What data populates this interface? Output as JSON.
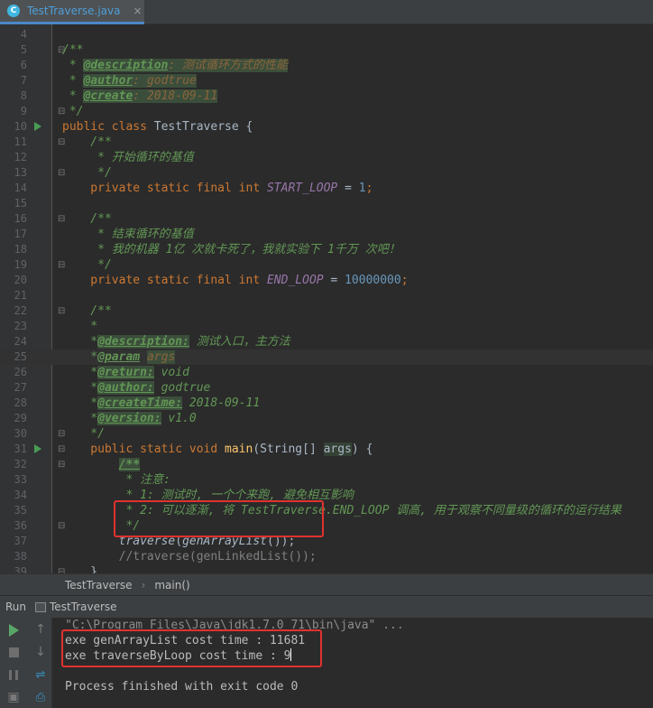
{
  "tab": {
    "icon": "C",
    "label": "TestTraverse.java",
    "close": "×"
  },
  "lines": [
    {
      "n": "4",
      "segs": []
    },
    {
      "n": "5",
      "fold": "⊟",
      "segs": [
        {
          "t": "/**",
          "c": "c-com"
        }
      ]
    },
    {
      "n": "6",
      "segs": [
        {
          "t": " * ",
          "c": "c-com"
        },
        {
          "t": "@description",
          "c": "c-tag"
        },
        {
          "t": ": 测试循环方式的性能",
          "c": "c-tagval"
        }
      ]
    },
    {
      "n": "7",
      "segs": [
        {
          "t": " * ",
          "c": "c-com"
        },
        {
          "t": "@author",
          "c": "c-tag"
        },
        {
          "t": ": godtrue",
          "c": "c-tagval"
        }
      ]
    },
    {
      "n": "8",
      "segs": [
        {
          "t": " * ",
          "c": "c-com"
        },
        {
          "t": "@create",
          "c": "c-tag"
        },
        {
          "t": ": 2018-09-11",
          "c": "c-tagval"
        }
      ]
    },
    {
      "n": "9",
      "fold": "⊟",
      "segs": [
        {
          "t": " */",
          "c": "c-com"
        }
      ]
    },
    {
      "n": "10",
      "run": true,
      "segs": [
        {
          "t": "public class ",
          "c": "c-kw"
        },
        {
          "t": "TestTraverse {",
          "c": ""
        }
      ]
    },
    {
      "n": "11",
      "fold": "⊟",
      "segs": [
        {
          "t": "    /**",
          "c": "c-com"
        }
      ]
    },
    {
      "n": "12",
      "segs": [
        {
          "t": "     * 开始循环的基值",
          "c": "c-com"
        }
      ]
    },
    {
      "n": "13",
      "fold": "⊟",
      "segs": [
        {
          "t": "     */",
          "c": "c-com"
        }
      ]
    },
    {
      "n": "14",
      "segs": [
        {
          "t": "    private static final int ",
          "c": "c-kw"
        },
        {
          "t": "START_LOOP",
          "c": "c-field"
        },
        {
          "t": " = ",
          "c": ""
        },
        {
          "t": "1",
          "c": "c-num"
        },
        {
          "t": ";",
          "c": "c-kw"
        }
      ]
    },
    {
      "n": "15",
      "segs": []
    },
    {
      "n": "16",
      "fold": "⊟",
      "segs": [
        {
          "t": "    /**",
          "c": "c-com"
        }
      ]
    },
    {
      "n": "17",
      "segs": [
        {
          "t": "     * 结束循环的基值",
          "c": "c-com"
        }
      ]
    },
    {
      "n": "18",
      "segs": [
        {
          "t": "     * 我的机器 1亿 次就卡死了，我就实验下 1千万 次吧！",
          "c": "c-com"
        }
      ]
    },
    {
      "n": "19",
      "fold": "⊟",
      "segs": [
        {
          "t": "     */",
          "c": "c-com"
        }
      ]
    },
    {
      "n": "20",
      "segs": [
        {
          "t": "    private static final int ",
          "c": "c-kw"
        },
        {
          "t": "END_LOOP",
          "c": "c-field"
        },
        {
          "t": " = ",
          "c": ""
        },
        {
          "t": "10000000",
          "c": "c-num"
        },
        {
          "t": ";",
          "c": "c-kw"
        }
      ]
    },
    {
      "n": "21",
      "segs": []
    },
    {
      "n": "22",
      "fold": "⊟",
      "segs": [
        {
          "t": "    /**",
          "c": "c-com"
        }
      ]
    },
    {
      "n": "23",
      "segs": [
        {
          "t": "    *",
          "c": "c-com"
        }
      ]
    },
    {
      "n": "24",
      "segs": [
        {
          "t": "    *",
          "c": "c-com"
        },
        {
          "t": "@description:",
          "c": "c-tag"
        },
        {
          "t": " 测试入口，主方法",
          "c": "c-com"
        }
      ]
    },
    {
      "n": "25",
      "current": true,
      "segs": [
        {
          "t": "    *",
          "c": "c-com"
        },
        {
          "t": "@param",
          "c": "c-paramtag"
        },
        {
          "t": " ",
          "c": "c-com"
        },
        {
          "t": "args",
          "c": "c-tagval"
        }
      ]
    },
    {
      "n": "26",
      "segs": [
        {
          "t": "    *",
          "c": "c-com"
        },
        {
          "t": "@return:",
          "c": "c-tag"
        },
        {
          "t": " void",
          "c": "c-com"
        }
      ]
    },
    {
      "n": "27",
      "segs": [
        {
          "t": "    *",
          "c": "c-com"
        },
        {
          "t": "@author:",
          "c": "c-tag"
        },
        {
          "t": " godtrue",
          "c": "c-com"
        }
      ]
    },
    {
      "n": "28",
      "segs": [
        {
          "t": "    *",
          "c": "c-com"
        },
        {
          "t": "@createTime:",
          "c": "c-tag"
        },
        {
          "t": " 2018-09-11",
          "c": "c-com"
        }
      ]
    },
    {
      "n": "29",
      "segs": [
        {
          "t": "    *",
          "c": "c-com"
        },
        {
          "t": "@version:",
          "c": "c-tag"
        },
        {
          "t": " v1.0",
          "c": "c-com"
        }
      ]
    },
    {
      "n": "30",
      "fold": "⊟",
      "segs": [
        {
          "t": "    */",
          "c": "c-com"
        }
      ]
    },
    {
      "n": "31",
      "run": true,
      "fold": "⊟",
      "segs": [
        {
          "t": "    public static void ",
          "c": "c-kw"
        },
        {
          "t": "main",
          "c": "c-method"
        },
        {
          "t": "(String[] ",
          "c": ""
        },
        {
          "t": "args",
          "c": "c-param"
        },
        {
          "t": ") {",
          "c": ""
        }
      ]
    },
    {
      "n": "32",
      "fold": "⊟",
      "segs": [
        {
          "t": "        ",
          "c": ""
        },
        {
          "t": "/**",
          "c": "c-tag"
        }
      ]
    },
    {
      "n": "33",
      "segs": [
        {
          "t": "         * 注意:",
          "c": "c-com"
        }
      ]
    },
    {
      "n": "34",
      "segs": [
        {
          "t": "         * 1: 测试时, 一个个来跑, 避免相互影响",
          "c": "c-com"
        }
      ]
    },
    {
      "n": "35",
      "segs": [
        {
          "t": "         * 2: 可以逐渐, 将 TestTraverse.END_LOOP 调高, 用于观察不同量级的循环的运行结果",
          "c": "c-com"
        }
      ]
    },
    {
      "n": "36",
      "fold": "⊟",
      "segs": [
        {
          "t": "         */",
          "c": "c-com"
        }
      ]
    },
    {
      "n": "37",
      "segs": [
        {
          "t": "        ",
          "c": ""
        },
        {
          "t": "traverse",
          "c": "c-it"
        },
        {
          "t": "(",
          "c": ""
        },
        {
          "t": "genArrayList",
          "c": "c-it"
        },
        {
          "t": "());",
          "c": ""
        }
      ]
    },
    {
      "n": "38",
      "segs": [
        {
          "t": "        //traverse(genLinkedList());",
          "c": "c-gray"
        }
      ]
    },
    {
      "n": "39",
      "fold": "⊟",
      "segs": [
        {
          "t": "    }",
          "c": ""
        }
      ]
    }
  ],
  "breadcrumb": {
    "class_name": "TestTraverse",
    "sep": "›",
    "method": "main()"
  },
  "runbar": {
    "label": "Run",
    "config": "TestTraverse"
  },
  "console": {
    "command": "\"C:\\Program Files\\Java\\jdk1.7.0_71\\bin\\java\" ...",
    "out1": "exe genArrayList cost time : 11681",
    "out2": "exe traverseByLoop cost time : 9",
    "finished": "Process finished with exit code 0"
  },
  "colors": {
    "highlight_box": "#e0322f",
    "background": "#2b2b2b",
    "keyword": "#cc7832",
    "comment": "#629755"
  }
}
